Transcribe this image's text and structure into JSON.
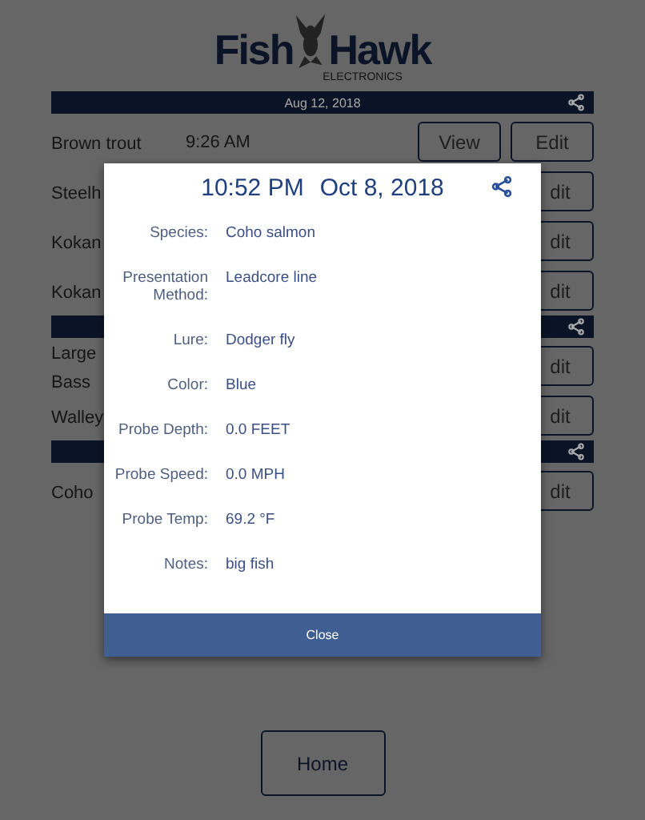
{
  "logo": {
    "word_left": "Fish",
    "word_right": "Hawk",
    "tagline": "ELECTRONICS"
  },
  "log_sections": [
    {
      "date": "Aug 12, 2018",
      "entries": [
        {
          "species": "Brown trout",
          "time": "9:26 AM",
          "buttons": [
            "View",
            "Edit"
          ]
        },
        {
          "species": "Steelh",
          "buttons": [
            "dit"
          ]
        },
        {
          "species": "Kokan",
          "buttons": [
            "dit"
          ]
        },
        {
          "species": "Kokan",
          "buttons": [
            "dit"
          ]
        }
      ]
    },
    {
      "entries": [
        {
          "species": "Large\nBass",
          "buttons": [
            "dit"
          ]
        },
        {
          "species": "Walley",
          "buttons": [
            "dit"
          ]
        }
      ]
    },
    {
      "entries": [
        {
          "species": "Coho",
          "buttons": [
            "dit"
          ]
        }
      ]
    }
  ],
  "home_button": "Home",
  "dialog": {
    "time": "10:52 PM",
    "date": "Oct 8, 2018",
    "fields": [
      {
        "label": "Species:",
        "value": "Coho salmon"
      },
      {
        "label": "Presentation Method:",
        "value": "Leadcore line"
      },
      {
        "label": "Lure:",
        "value": "Dodger fly"
      },
      {
        "label": "Color:",
        "value": "Blue"
      },
      {
        "label": "Probe Depth:",
        "value": "0.0 FEET"
      },
      {
        "label": "Probe Speed:",
        "value": "0.0 MPH"
      },
      {
        "label": "Probe Temp:",
        "value": "69.2 °F"
      },
      {
        "label": "Notes:",
        "value": "big fish"
      }
    ],
    "close_button": "Close"
  }
}
